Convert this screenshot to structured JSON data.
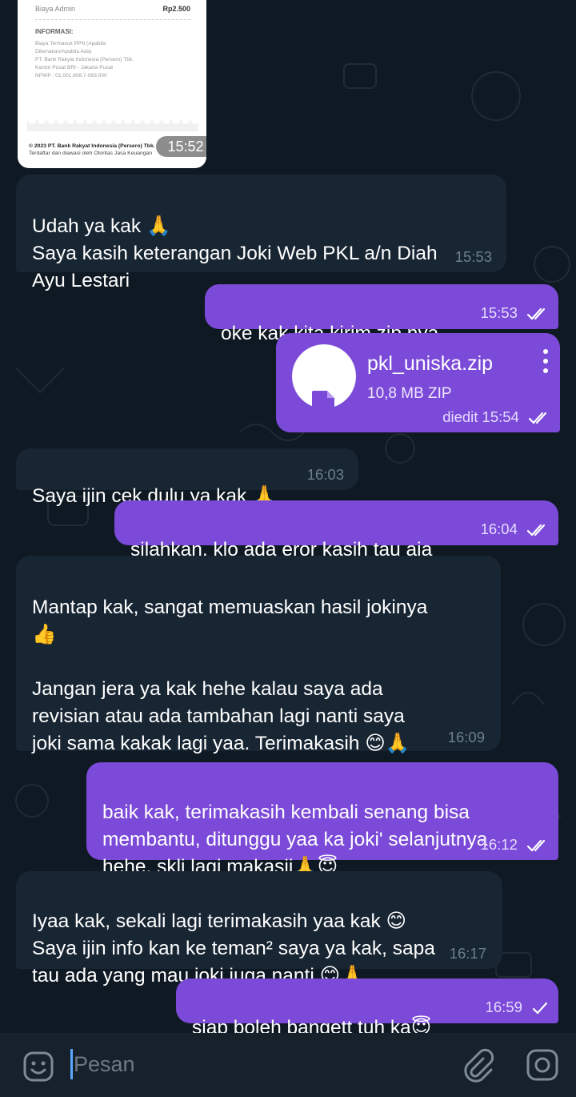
{
  "receipt": {
    "fee_label": "Biaya Admin",
    "fee_amount": "Rp2.500",
    "info_heading": "INFORMASI:",
    "info_text": "Biaya Termasuk PPN (Apabila\nDikenakan/Apabila Ada)\nPT. Bank Rakyat Indonesia (Persero) Tbk.\nKantor Pusat BRI - Jakarta Pusat\nNPWP : 01.001.608.7-093.000",
    "footer_line1": "© 2023 PT. Bank Rakyat Indonesia (Persero) Tbk.",
    "footer_line2": "Terdaftar dan diawasi oleh Otoritas Jasa Keuangan",
    "time": "15:52"
  },
  "messages": [
    {
      "text": "Udah ya kak 🙏\nSaya kasih keterangan Joki Web PKL a/n Diah\nAyu Lestari",
      "time": "15:53"
    },
    {
      "text": "oke kak kita kirim zip nya",
      "time": "15:53"
    },
    {
      "file_name": "pkl_uniska.zip",
      "file_size": "10,8 MB ZIP",
      "time": "diedit 15:54"
    },
    {
      "text": "Saya ijin cek dulu ya kak 🙏",
      "time": "16:03"
    },
    {
      "text": "silahkan, klo ada eror kasih tau aja",
      "time": "16:04"
    },
    {
      "text": "Mantap kak, sangat memuaskan hasil jokinya\n👍\n\nJangan jera ya kak hehe kalau saya ada\nrevisian atau ada  tambahan lagi nanti saya\njoki sama kakak lagi yaa. Terimakasih 😊🙏",
      "time": "16:09"
    },
    {
      "text": "baik kak, terimakasih kembali senang bisa\nmembantu, ditunggu yaa ka joki' selanjutnya\nhehe, skli lagi makasii🙏😇",
      "time": "16:12"
    },
    {
      "text": "Iyaa kak, sekali lagi terimakasih yaa kak 😊\nSaya ijin info kan ke teman² saya ya kak, sapa\ntau ada yang mau joki juga nanti 😊🙏",
      "time": "16:17"
    },
    {
      "text": "siap boleh bangett tuh ka😇",
      "time": "16:59"
    }
  ],
  "input": {
    "placeholder": "Pesan"
  },
  "colors": {
    "incoming": "#182533",
    "outgoing": "#7b4ad8",
    "background": "#0f1923"
  },
  "icons": {
    "emoji": "emoji-icon",
    "attach": "paperclip-icon",
    "camera": "camera-icon",
    "file": "file-icon",
    "read": "double-check-icon",
    "sent": "check-icon"
  }
}
